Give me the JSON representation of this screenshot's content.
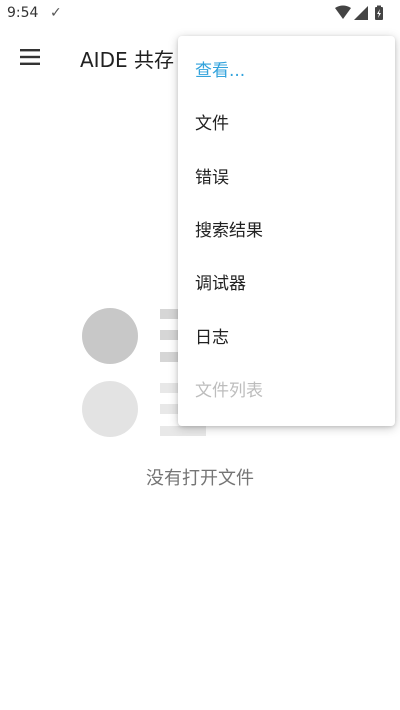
{
  "status_bar": {
    "time": "9:54",
    "check_glyph": "✓",
    "icons": [
      "wifi-icon",
      "cell-signal-icon",
      "battery-charging-icon"
    ]
  },
  "app_bar": {
    "menu_icon": "hamburger-menu-icon",
    "title": "AIDE 共存"
  },
  "overflow_menu": {
    "items": [
      {
        "label": "查看...",
        "state": "highlighted"
      },
      {
        "label": "文件",
        "state": "enabled"
      },
      {
        "label": "错误",
        "state": "enabled"
      },
      {
        "label": "搜索结果",
        "state": "enabled"
      },
      {
        "label": "调试器",
        "state": "enabled"
      },
      {
        "label": "日志",
        "state": "enabled"
      },
      {
        "label": "文件列表",
        "state": "disabled"
      }
    ]
  },
  "empty_state": {
    "message": "没有打开文件",
    "icon": "empty-files-illustration"
  },
  "colors": {
    "accent": "#33a3dc",
    "disabled_text": "#bdbdbd",
    "secondary_text": "#757575",
    "primary_text": "#212121",
    "background": "#ffffff"
  }
}
